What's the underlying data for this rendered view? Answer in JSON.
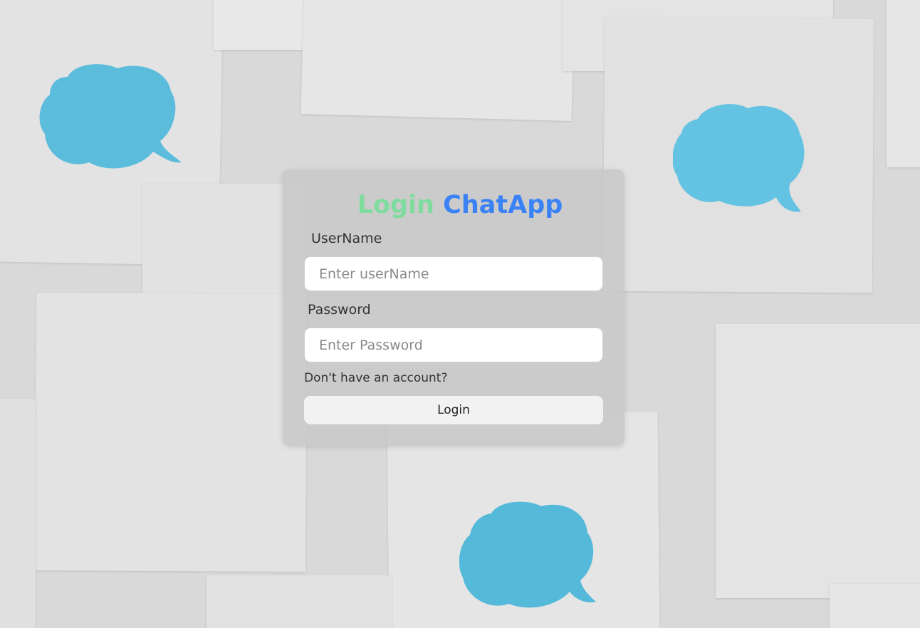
{
  "title": {
    "part1": "Login",
    "part2": "ChatApp"
  },
  "username": {
    "label": "UserName",
    "placeholder": "Enter userName"
  },
  "password": {
    "label": "Password",
    "placeholder": "Enter Password"
  },
  "signup_link": "Don't have an account?",
  "login_button": "Login",
  "colors": {
    "title_part1": "#7fdc9e",
    "title_part2": "#3b82f6",
    "bubble": "#5bbcdc"
  }
}
